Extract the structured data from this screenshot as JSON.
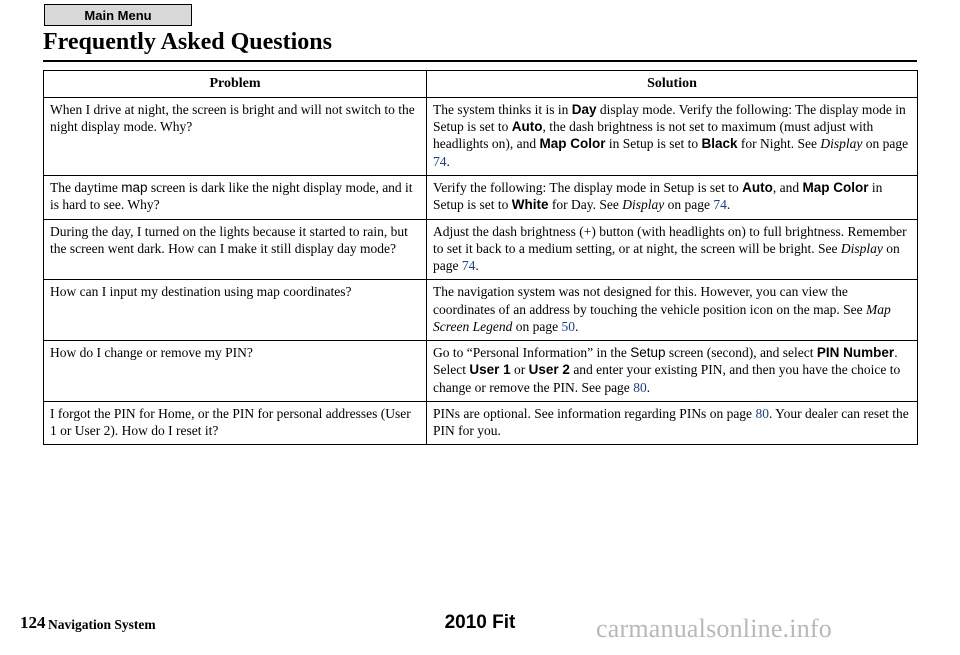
{
  "header": {
    "menu_tab_label": "Main Menu",
    "page_title": "Frequently Asked Questions"
  },
  "table": {
    "columns": [
      "Problem",
      "Solution"
    ],
    "rows": [
      {
        "problem": [
          {
            "t": "When I drive at night, the screen is bright and will not switch to the night display mode. Why?",
            "s": "plain"
          }
        ],
        "solution": [
          {
            "t": "The system thinks it is in ",
            "s": "plain"
          },
          {
            "t": "Day",
            "s": "sans-b"
          },
          {
            "t": " display mode. Verify the following: The display mode in Setup is set to ",
            "s": "plain"
          },
          {
            "t": "Auto",
            "s": "sans-b"
          },
          {
            "t": ", the dash brightness is not set to maximum (must adjust with headlights on), and ",
            "s": "plain"
          },
          {
            "t": "Map Color",
            "s": "sans-b"
          },
          {
            "t": " in Setup is set to ",
            "s": "plain"
          },
          {
            "t": "Black",
            "s": "sans-b"
          },
          {
            "t": " for Night. See ",
            "s": "plain"
          },
          {
            "t": "Display",
            "s": "ital"
          },
          {
            "t": " on page ",
            "s": "plain"
          },
          {
            "t": "74",
            "s": "link"
          },
          {
            "t": ".",
            "s": "plain"
          }
        ]
      },
      {
        "problem": [
          {
            "t": "The daytime ",
            "s": "plain"
          },
          {
            "t": "map",
            "s": "sans"
          },
          {
            "t": " screen is dark like the night display mode, and it is hard to see. Why?",
            "s": "plain"
          }
        ],
        "solution": [
          {
            "t": "Verify the following: The display mode in Setup is set to ",
            "s": "plain"
          },
          {
            "t": "Auto",
            "s": "sans-b"
          },
          {
            "t": ", and ",
            "s": "plain"
          },
          {
            "t": "Map Color",
            "s": "sans-b"
          },
          {
            "t": " in Setup is set to ",
            "s": "plain"
          },
          {
            "t": "White",
            "s": "sans-b"
          },
          {
            "t": " for Day. See ",
            "s": "plain"
          },
          {
            "t": "Display",
            "s": "ital"
          },
          {
            "t": " on page ",
            "s": "plain"
          },
          {
            "t": "74",
            "s": "link"
          },
          {
            "t": ".",
            "s": "plain"
          }
        ]
      },
      {
        "problem": [
          {
            "t": "During the day, I turned on the lights because it started to rain, but the screen went dark. How can I make it still display day mode?",
            "s": "plain"
          }
        ],
        "solution": [
          {
            "t": "Adjust the dash brightness (+) button (with headlights on) to full brightness. Remember to set it back to a medium setting, or at night, the screen will be bright. See ",
            "s": "plain"
          },
          {
            "t": "Display",
            "s": "ital"
          },
          {
            "t": " on page ",
            "s": "plain"
          },
          {
            "t": "74",
            "s": "link"
          },
          {
            "t": ".",
            "s": "plain"
          }
        ]
      },
      {
        "problem": [
          {
            "t": "How can I input my destination using map coordinates?",
            "s": "plain"
          }
        ],
        "solution": [
          {
            "t": "The navigation system was not designed for this. However, you can view the coordinates of an address by touching the vehicle position icon on the map. See ",
            "s": "plain"
          },
          {
            "t": "Map Screen Legend",
            "s": "ital"
          },
          {
            "t": " on page ",
            "s": "plain"
          },
          {
            "t": "50",
            "s": "link"
          },
          {
            "t": ".",
            "s": "plain"
          }
        ]
      },
      {
        "problem": [
          {
            "t": "How do I change or remove my PIN?",
            "s": "plain"
          }
        ],
        "solution": [
          {
            "t": "Go to “Personal Information” in the ",
            "s": "plain"
          },
          {
            "t": "Setup",
            "s": "sans"
          },
          {
            "t": " screen (second), and select ",
            "s": "plain"
          },
          {
            "t": "PIN Number",
            "s": "sans-b"
          },
          {
            "t": ". Select ",
            "s": "plain"
          },
          {
            "t": "User 1",
            "s": "sans-b"
          },
          {
            "t": " or ",
            "s": "plain"
          },
          {
            "t": "User 2",
            "s": "sans-b"
          },
          {
            "t": " and enter your existing PIN, and then you have the choice to change or remove the PIN. See page ",
            "s": "plain"
          },
          {
            "t": "80",
            "s": "link"
          },
          {
            "t": ".",
            "s": "plain"
          }
        ]
      },
      {
        "problem": [
          {
            "t": "I forgot the PIN for Home, or the PIN for personal addresses (User 1 or User 2). How do I reset it?",
            "s": "plain"
          }
        ],
        "solution": [
          {
            "t": "PINs are optional. See information regarding PINs on page ",
            "s": "plain"
          },
          {
            "t": "80",
            "s": "link"
          },
          {
            "t": ". Your dealer can reset the PIN for you.",
            "s": "plain"
          }
        ]
      }
    ]
  },
  "footer": {
    "page_number": "124",
    "section_label": "Navigation System",
    "model_label": "2010 Fit",
    "watermark": "carmanualsonline.info"
  }
}
